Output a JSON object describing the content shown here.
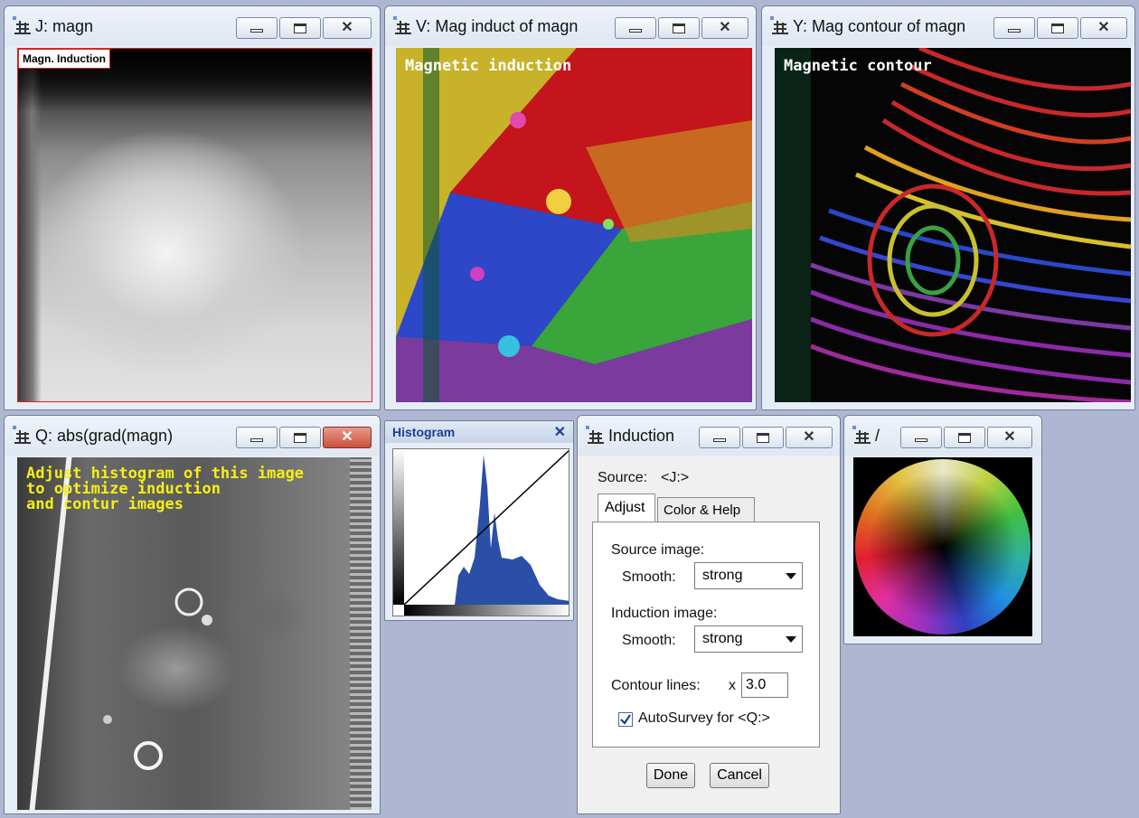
{
  "windows": {
    "j": {
      "title": "J: magn",
      "label": "Magn. Induction"
    },
    "v": {
      "title": "V: Mag induct of magn",
      "overlay": "Magnetic induction"
    },
    "y": {
      "title": "Y: Mag contour of magn",
      "overlay": "Magnetic contour"
    },
    "q": {
      "title": "Q: abs(grad(magn)",
      "note": "Adjust histogram of this image\nto optimize induction\nand contur images"
    },
    "histogram": {
      "title": "Histogram",
      "close": "✕"
    },
    "induction": {
      "title": "Induction",
      "source_label": "Source:",
      "source_value": "<J:>",
      "tabs": [
        "Adjust",
        "Color & Help"
      ],
      "source_image_label": "Source image:",
      "smooth_label": "Smooth:",
      "source_smooth_value": "strong",
      "induction_image_label": "Induction image:",
      "induction_smooth_value": "strong",
      "contour_label": "Contour lines:",
      "contour_prefix": "x",
      "contour_value": "3.0",
      "autosurvey_label": "AutoSurvey for <Q:>",
      "autosurvey_checked": true,
      "done_label": "Done",
      "cancel_label": "Cancel"
    },
    "colorwheel": {
      "title": "/"
    }
  },
  "icons": {
    "app": "app-icon",
    "minimize": "minimize-icon",
    "maximize": "maximize-icon",
    "close": "close-icon"
  }
}
